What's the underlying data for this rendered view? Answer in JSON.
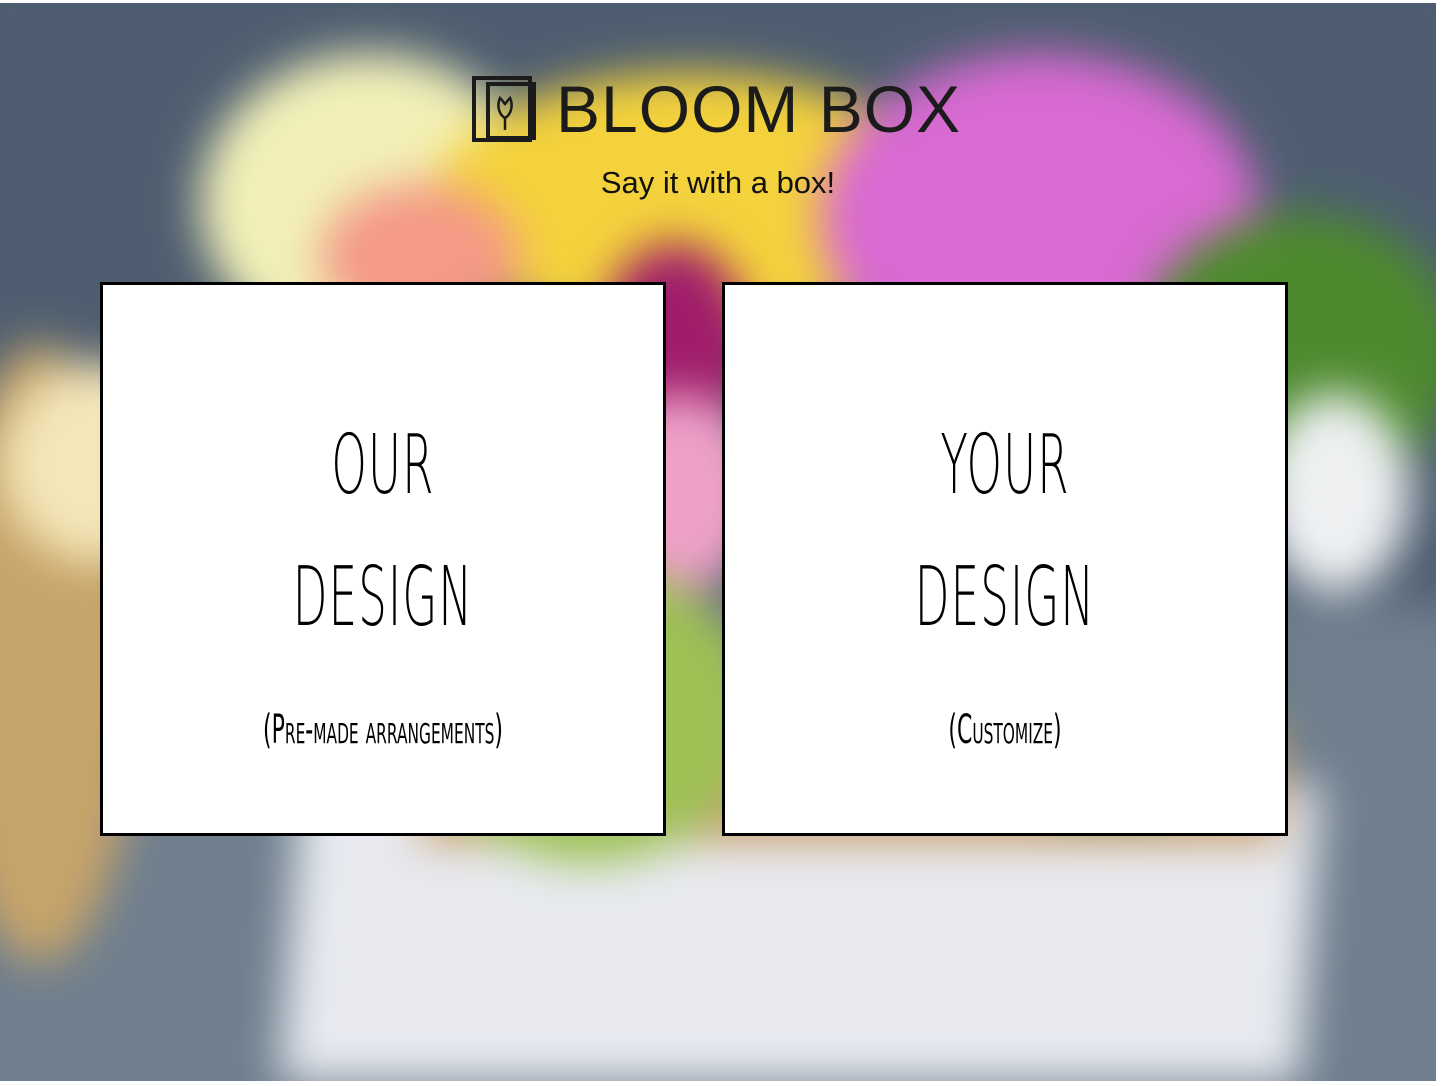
{
  "brand": {
    "name": "BLOOM BOX",
    "tagline": "Say it with a box!",
    "logo_icon": "tulip-box-icon"
  },
  "cards": [
    {
      "title_line1": "OUR",
      "title_line2": "DESIGN",
      "subtitle": "(Pre-made arrangements)"
    },
    {
      "title_line1": "YOUR",
      "title_line2": "DESIGN",
      "subtitle": "(Customize)"
    }
  ],
  "colors": {
    "background": "#4f6070",
    "card_background": "#ffffff",
    "card_border": "#000000"
  }
}
